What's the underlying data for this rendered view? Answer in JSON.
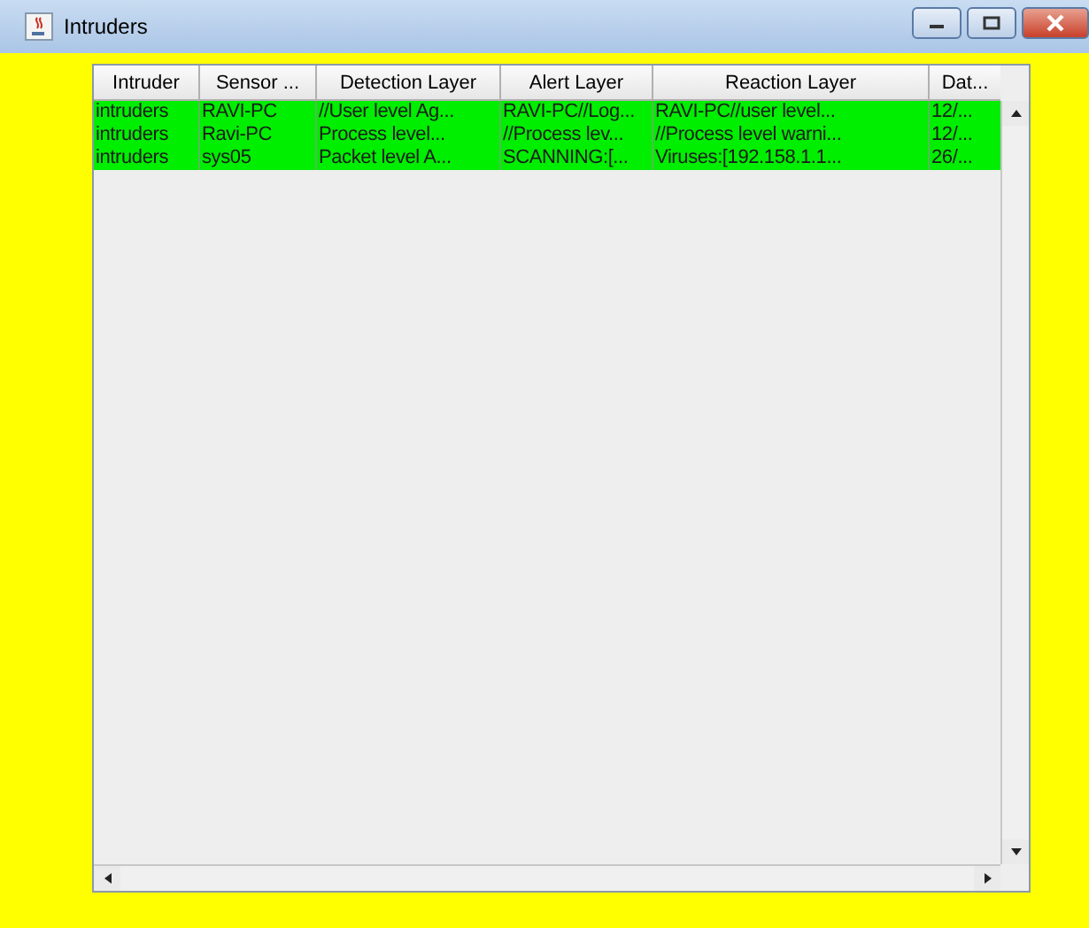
{
  "window": {
    "title": "Intruders"
  },
  "table": {
    "columns": [
      "Intruder",
      "Sensor ...",
      "Detection Layer",
      "Alert Layer",
      "Reaction Layer",
      "Dat..."
    ],
    "rows": [
      {
        "cells": [
          "intruders",
          "RAVI-PC",
          "//User level Ag...",
          "RAVI-PC//Log...",
          "RAVI-PC//user level...",
          "12/..."
        ]
      },
      {
        "cells": [
          "intruders",
          "Ravi-PC",
          "Process  level...",
          "//Process lev...",
          "//Process level warni...",
          "12/..."
        ]
      },
      {
        "cells": [
          "intruders",
          "sys05",
          "Packet  level A...",
          "SCANNING:[...",
          "Viruses:[192.158.1.1...",
          "26/..."
        ]
      }
    ]
  }
}
